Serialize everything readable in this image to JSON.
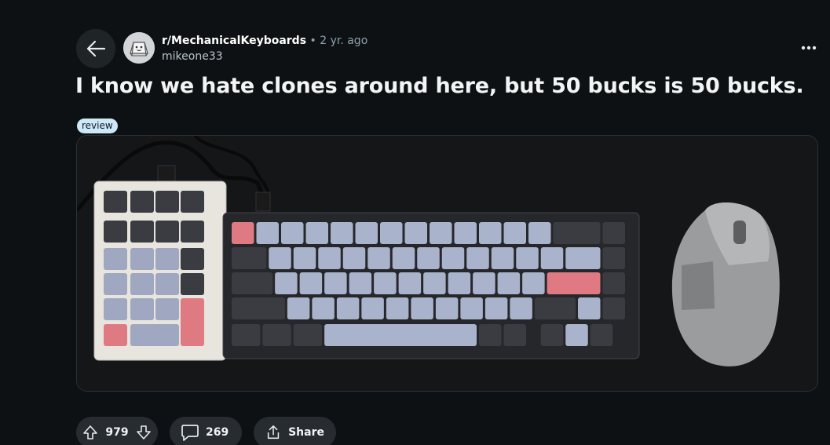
{
  "post": {
    "subreddit": "r/MechanicalKeyboards",
    "time_sep": "•",
    "time": "2 yr. ago",
    "author": "mikeone33",
    "title": "I know we hate clones around here, but 50 bucks is 50 bucks.",
    "flair": "review",
    "flair_color": "#cfe8f7"
  },
  "actions": {
    "votes": "979",
    "comments": "269",
    "share": "Share"
  },
  "icons": {
    "back": "back-arrow-icon",
    "avatar": "subreddit-keycap-avatar",
    "more": "more-options-icon",
    "upvote": "upvote-arrow-icon",
    "downvote": "downvote-arrow-icon",
    "comment": "comment-bubble-icon",
    "share": "share-icon"
  },
  "colors": {
    "background": "#0e1113",
    "pill": "#272c30",
    "accent_key": "#e07a82"
  }
}
